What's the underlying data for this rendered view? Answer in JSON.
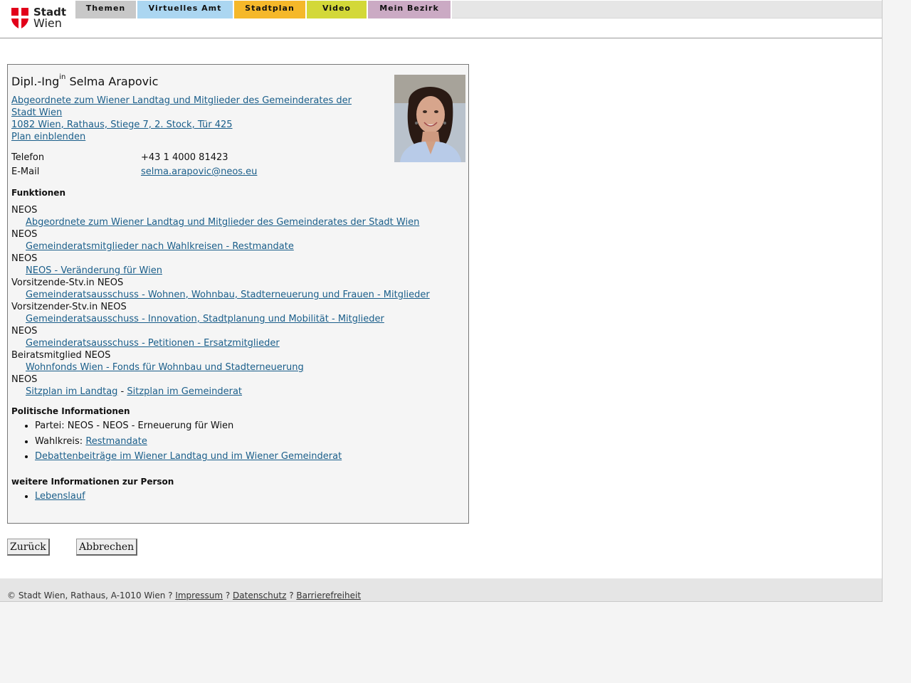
{
  "header": {
    "logo": {
      "line1": "Stadt",
      "line2": "Wien",
      "colors": {
        "shield": "#e2001a"
      }
    },
    "nav": [
      {
        "label": "Themen",
        "color": "#c8c8c8"
      },
      {
        "label": "Virtuelles Amt",
        "color": "#abd6f1"
      },
      {
        "label": "Stadtplan",
        "color": "#f5b82a"
      },
      {
        "label": "Video",
        "color": "#d3d838"
      },
      {
        "label": "Mein Bezirk",
        "color": "#cbaac4"
      }
    ]
  },
  "person": {
    "title_prefix": "Dipl.-Ing",
    "title_suffix": "in",
    "name": "Selma Arapovic",
    "position_line1": "Abgeordnete zum Wiener Landtag und Mitglieder des Gemeinderates der",
    "position_line2": "Stadt Wien ",
    "address": "1082 Wien, Rathaus, Stiege 7, 2. Stock, Tür 425",
    "plan_link": "Plan einblenden",
    "phone_label": "Telefon",
    "phone": "+43 1 4000 81423",
    "email_label": "E-Mail",
    "email": "selma.arapovic@neos.eu"
  },
  "functions": {
    "heading": "Funktionen",
    "items": [
      {
        "role": "NEOS",
        "link": "Abgeordnete zum Wiener Landtag und Mitglieder des Gemeinderates der Stadt Wien"
      },
      {
        "role": "NEOS",
        "link": "Gemeinderatsmitglieder nach Wahlkreisen - Restmandate"
      },
      {
        "role": "NEOS",
        "link": "NEOS - Veränderung für Wien"
      },
      {
        "role": "Vorsitzende-Stv.in NEOS",
        "link": "Gemeinderatsausschuss - Wohnen, Wohnbau, Stadterneuerung und Frauen - Mitglieder"
      },
      {
        "role": "Vorsitzender-Stv.in NEOS",
        "link": "Gemeinderatsausschuss - Innovation, Stadtplanung und Mobilität - Mitglieder"
      },
      {
        "role": "NEOS",
        "link": "Gemeinderatsausschuss - Petitionen - Ersatzmitglieder"
      },
      {
        "role": "Beiratsmitglied NEOS",
        "link": "Wohnfonds Wien - Fonds für Wohnbau und Stadterneuerung"
      }
    ],
    "last_role": "NEOS",
    "seat_link1": "Sitzplan im Landtag",
    "seat_separator": " - ",
    "seat_link2": "Sitzplan im Gemeinderat"
  },
  "political": {
    "heading": "Politische Informationen",
    "party": "Partei: NEOS - NEOS - Erneuerung für Wien",
    "constituency_label": "Wahlkreis: ",
    "constituency_link": "Restmandate",
    "debates_link": "Debattenbeiträge im Wiener Landtag und im Wiener Gemeinderat"
  },
  "more": {
    "heading": "weitere Informationen zur Person",
    "cv_link": "Lebenslauf"
  },
  "buttons": {
    "back": "Zurück",
    "cancel": "Abbrechen"
  },
  "footer": {
    "copyright": "© Stadt Wien, Rathaus, A-1010 Wien ? ",
    "impressum": "Impressum",
    "sep1": " ? ",
    "datenschutz": "Datenschutz",
    "sep2": " ? ",
    "barrierefreiheit": "Barrierefreiheit"
  }
}
